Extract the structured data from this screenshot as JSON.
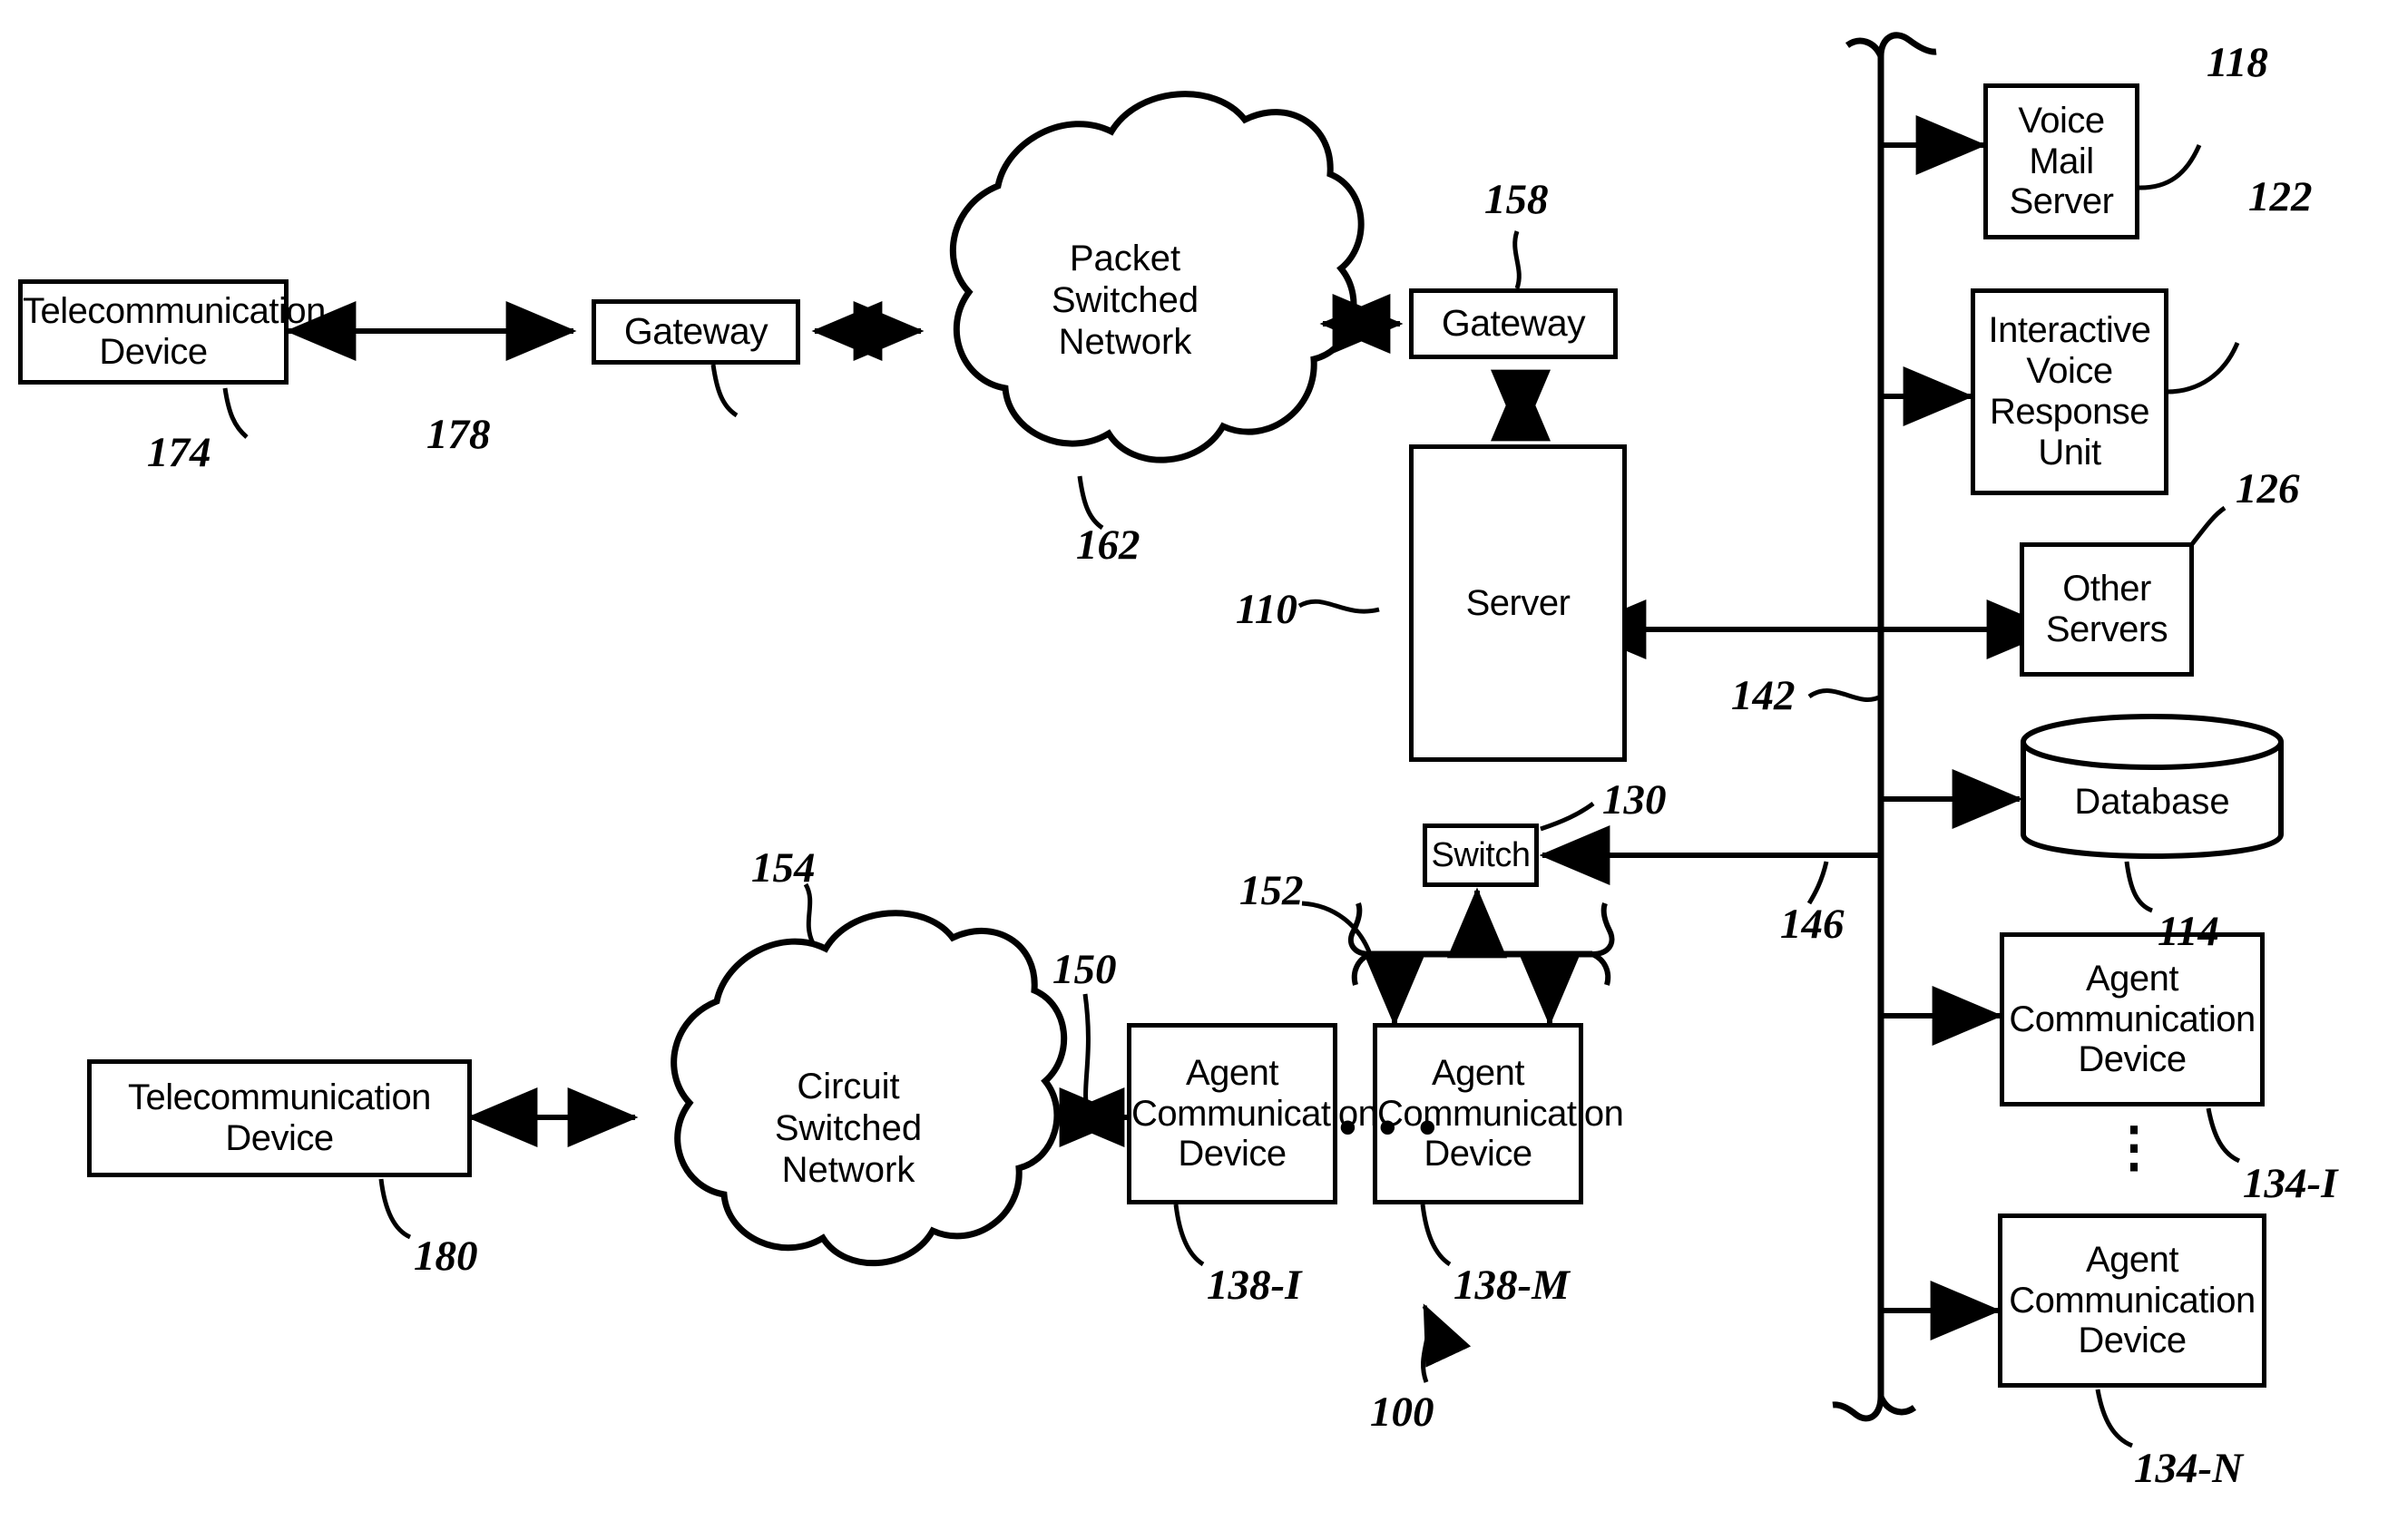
{
  "figure": {
    "type": "patent-block-diagram",
    "overall_reference": "100"
  },
  "nodes": {
    "telecom_device_top": {
      "label": "Telecommunication Device",
      "ref": "174"
    },
    "gateway_left": {
      "label": "Gateway",
      "ref": "178"
    },
    "packet_network": {
      "label": "Packet Switched Network",
      "ref": "162"
    },
    "gateway_right": {
      "label": "Gateway",
      "ref": "158"
    },
    "server": {
      "label": "Server",
      "ref": "110"
    },
    "switch": {
      "label": "Switch",
      "ref": "130"
    },
    "voice_mail_server": {
      "label": "Voice Mail Server",
      "ref": "118"
    },
    "ivr_unit": {
      "label": "Interactive Voice Response Unit",
      "ref": "122"
    },
    "other_servers": {
      "label": "Other Servers",
      "ref": "126"
    },
    "database": {
      "label": "Database",
      "ref": "114"
    },
    "agent_device_134_i": {
      "label": "Agent Communication Device",
      "ref": "134-I"
    },
    "agent_device_134_n": {
      "label": "Agent Communication Device",
      "ref": "134-N"
    },
    "telecom_device_bottom": {
      "label": "Telecommunication Device",
      "ref": "180"
    },
    "circuit_network": {
      "label": "Circuit Switched Network",
      "ref": "154"
    },
    "agent_device_138_i": {
      "label": "Agent Communication Device",
      "ref": "138-I"
    },
    "agent_device_138_m": {
      "label": "Agent Communication Device",
      "ref": "138-M"
    }
  },
  "connections": {
    "csn_to_agent_link_ref": "150",
    "agent_bus_left_ref": "152",
    "agent_bus_right_ref": "146",
    "server_bus_ref": "142"
  },
  "ellipses": {
    "horizontal": "• • •",
    "vertical": "⋮"
  },
  "colors": {
    "line": "#000000",
    "background": "#ffffff"
  }
}
